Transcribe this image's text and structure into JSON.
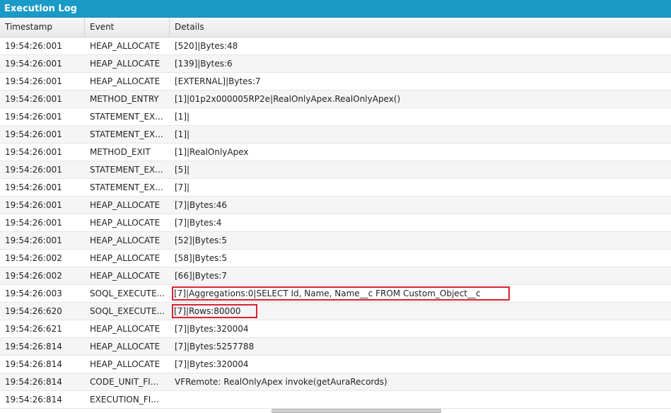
{
  "panel": {
    "title": "Execution Log"
  },
  "columns": {
    "timestamp": "Timestamp",
    "event": "Event",
    "details": "Details"
  },
  "highlight_color": "#d9232e",
  "rows": [
    {
      "ts": "19:54:26:001",
      "event": "HEAP_ALLOCATE",
      "details": "[520]|Bytes:48"
    },
    {
      "ts": "19:54:26:001",
      "event": "HEAP_ALLOCATE",
      "details": "[139]|Bytes:6"
    },
    {
      "ts": "19:54:26:001",
      "event": "HEAP_ALLOCATE",
      "details": "[EXTERNAL]|Bytes:7"
    },
    {
      "ts": "19:54:26:001",
      "event": "METHOD_ENTRY",
      "details": "[1]|01p2x000005RP2e|RealOnlyApex.RealOnlyApex()"
    },
    {
      "ts": "19:54:26:001",
      "event": "STATEMENT_EX...",
      "details": "[1]|"
    },
    {
      "ts": "19:54:26:001",
      "event": "STATEMENT_EX...",
      "details": "[1]|"
    },
    {
      "ts": "19:54:26:001",
      "event": "METHOD_EXIT",
      "details": "[1]|RealOnlyApex"
    },
    {
      "ts": "19:54:26:001",
      "event": "STATEMENT_EX...",
      "details": "[5]|"
    },
    {
      "ts": "19:54:26:001",
      "event": "STATEMENT_EX...",
      "details": "[7]|"
    },
    {
      "ts": "19:54:26:001",
      "event": "HEAP_ALLOCATE",
      "details": "[7]|Bytes:46"
    },
    {
      "ts": "19:54:26:001",
      "event": "HEAP_ALLOCATE",
      "details": "[7]|Bytes:4"
    },
    {
      "ts": "19:54:26:001",
      "event": "HEAP_ALLOCATE",
      "details": "[52]|Bytes:5"
    },
    {
      "ts": "19:54:26:002",
      "event": "HEAP_ALLOCATE",
      "details": "[58]|Bytes:5"
    },
    {
      "ts": "19:54:26:002",
      "event": "HEAP_ALLOCATE",
      "details": "[66]|Bytes:7"
    },
    {
      "ts": "19:54:26:003",
      "event": "SOQL_EXECUTE...",
      "details": "[7]|Aggregations:0|SELECT Id, Name, Name__c FROM Custom_Object__c"
    },
    {
      "ts": "19:54:26:620",
      "event": "SOQL_EXECUTE...",
      "details": "[7]|Rows:80000"
    },
    {
      "ts": "19:54:26:621",
      "event": "HEAP_ALLOCATE",
      "details": "[7]|Bytes:320004"
    },
    {
      "ts": "19:54:26:814",
      "event": "HEAP_ALLOCATE",
      "details": "[7]|Bytes:5257788"
    },
    {
      "ts": "19:54:26:814",
      "event": "HEAP_ALLOCATE",
      "details": "[7]|Bytes:320004"
    },
    {
      "ts": "19:54:26:814",
      "event": "CODE_UNIT_FI...",
      "details": "VFRemote: RealOnlyApex invoke(getAuraRecords)"
    },
    {
      "ts": "19:54:26:814",
      "event": "EXECUTION_FI...",
      "details": ""
    }
  ]
}
